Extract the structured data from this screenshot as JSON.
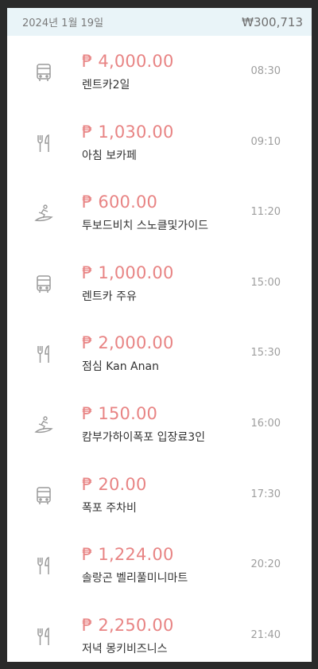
{
  "header": {
    "date": "2024년 1월 19일",
    "total": "₩300,713"
  },
  "expenses": [
    {
      "icon": "bus-icon",
      "amount": "₱ 4,000.00",
      "title": "렌트카2일",
      "time": "08:30"
    },
    {
      "icon": "fork-knife-icon",
      "amount": "₱ 1,030.00",
      "title": "아침 보카페",
      "time": "09:10"
    },
    {
      "icon": "surfer-icon",
      "amount": "₱ 600.00",
      "title": "투보드비치 스노클및가이드",
      "time": "11:20"
    },
    {
      "icon": "bus-icon",
      "amount": "₱ 1,000.00",
      "title": "렌트카 주유",
      "time": "15:00"
    },
    {
      "icon": "fork-knife-icon",
      "amount": "₱ 2,000.00",
      "title": "점심 Kan Anan",
      "time": "15:30"
    },
    {
      "icon": "surfer-icon",
      "amount": "₱ 150.00",
      "title": "캄부가하이폭포 입장료3인",
      "time": "16:00"
    },
    {
      "icon": "bus-icon",
      "amount": "₱ 20.00",
      "title": "폭포 주차비",
      "time": "17:30"
    },
    {
      "icon": "fork-knife-icon",
      "amount": "₱ 1,224.00",
      "title": "솔랑곤 벨리풀미니마트",
      "time": "20:20"
    },
    {
      "icon": "fork-knife-icon",
      "amount": "₱ 2,250.00",
      "title": "저녁 몽키비즈니스",
      "time": "21:40"
    }
  ]
}
